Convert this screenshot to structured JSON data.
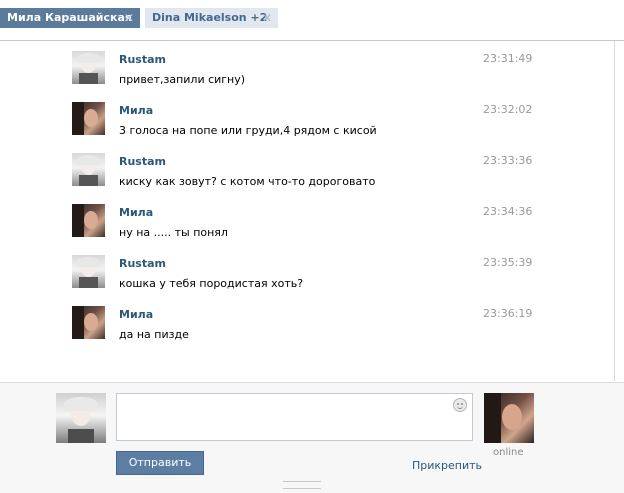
{
  "tabs": [
    {
      "label": "Мила Карашайская",
      "close": "✕"
    },
    {
      "label": "Dina Mikaelson +2",
      "close": "✕"
    }
  ],
  "messages": [
    {
      "author": "Rustam",
      "text": "привет,запили сигну)",
      "time": "23:31:49"
    },
    {
      "author": "Мила",
      "text": "3 голоса на попе или груди,4 рядом с кисой",
      "time": "23:32:02"
    },
    {
      "author": "Rustam",
      "text": "киску как зовут? с котом что-то дороговато",
      "time": "23:33:36"
    },
    {
      "author": "Мила",
      "text": "ну на ..... ты понял",
      "time": "23:34:36"
    },
    {
      "author": "Rustam",
      "text": "кошка у тебя породистая хоть?",
      "time": "23:35:39"
    },
    {
      "author": "Мила",
      "text": "да на пизде",
      "time": "23:36:19"
    }
  ],
  "compose": {
    "send_label": "Отправить",
    "attach_label": "Прикрепить",
    "peer_status": "online"
  },
  "colors": {
    "active_tab": "#5b7a9c",
    "inactive_tab": "#e1e7ee",
    "author_link": "#2b587a",
    "send_button": "#5d7ea3"
  },
  "icons": {
    "tab_close": "close-icon",
    "emoji": "smile-icon"
  }
}
